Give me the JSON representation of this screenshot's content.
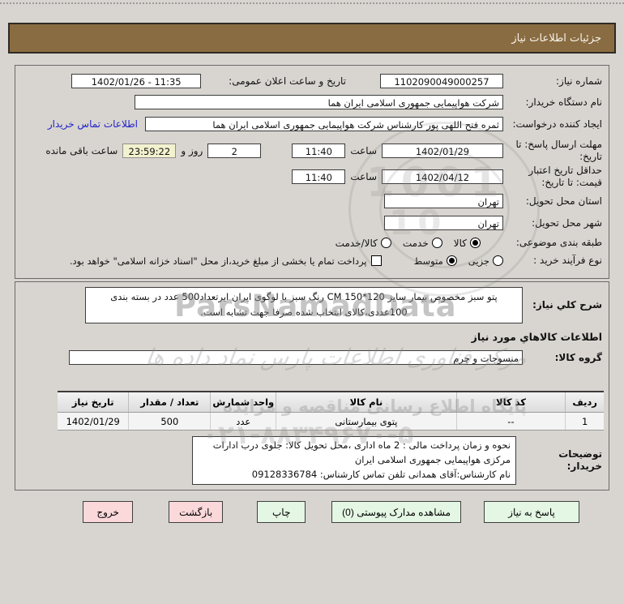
{
  "title_bar": {
    "label": "جزئیات اطلاعات نیاز"
  },
  "colors": {
    "accent_brown": "#8a6c42",
    "link_blue": "#2222cc",
    "countdown_bg": "#f2f2cf",
    "button_green": "#e4f6e4",
    "button_pink": "#fbd8da"
  },
  "panel1": {
    "need_number_label": "شماره نیاز:",
    "need_number_value": "1102090049000257",
    "announce_label": "تاریخ و ساعت اعلان عمومی:",
    "announce_value": "1402/01/26 - 11:35",
    "buyer_org_label": "نام دستگاه خریدار:",
    "buyer_org_value": "شرکت هواپیمایی جمهوری اسلامی ایران هما",
    "creator_label": "ایجاد کننده درخواست:",
    "creator_value": "ثمره فتح اللهی پور کارشناس شرکت هواپیمایی جمهوری اسلامی ایران هما",
    "contact_link": "اطلاعات تماس خریدار",
    "deadline_label": "مهلت ارسال پاسخ: تا تاریخ:",
    "deadline_date": "1402/01/29",
    "hour_label": "ساعت",
    "deadline_time": "11:40",
    "days_value": "2",
    "days_and_label": "روز و",
    "countdown_value": "23:59:22",
    "remaining_label": "ساعت باقی مانده",
    "validity_label": "حداقل تاریخ اعتبار قیمت: تا تاریخ:",
    "validity_date": "1402/04/12",
    "validity_time": "11:40",
    "province_label": "استان محل تحویل:",
    "province_value": "تهران",
    "city_label": "شهر محل تحویل:",
    "city_value": "تهران",
    "classification_label": "طبقه بندی موضوعی:",
    "class_options": [
      {
        "label": "کالا",
        "selected": true
      },
      {
        "label": "خدمت",
        "selected": false
      },
      {
        "label": "کالا/خدمت",
        "selected": false
      }
    ],
    "process_label": "نوع فرآیند خرید :",
    "process_options": [
      {
        "label": "جزیی",
        "selected": false
      },
      {
        "label": "متوسط",
        "selected": true
      }
    ],
    "treasury_checkbox_label": "پرداخت تمام یا بخشی از مبلغ خرید،از محل \"اسناد خزانه اسلامی\" خواهد بود.",
    "treasury_checked": false
  },
  "panel2": {
    "desc_label": "شرح کلي نیاز:",
    "desc_value": "پتو سبز مخصوص بیمار سایز  120*150 CM رنگ سبز با لوگوی ایران ایرتعداد500 عدد در بسته بندی 100عددی،کالای انتخاب شده صرفا جهت تشابه است.",
    "goods_info_heading": "اطلاعات کالاهاي مورد نیاز",
    "group_label": "گروه کالا:",
    "group_value": "منسوجات و چرم",
    "table": {
      "headers": [
        "ردیف",
        "کد کالا",
        "نام کالا",
        "واحد شمارش",
        "تعداد / مقدار",
        "تاریخ نیاز"
      ],
      "rows": [
        [
          "1",
          "--",
          "پتوی بیمارستانی",
          "عدد",
          "500",
          "1402/01/29"
        ]
      ]
    },
    "buyer_notes_label": "توضیحات خریدار:",
    "buyer_notes_lines": [
      "نحوه و زمان پرداخت مالی  : 2 ماه اداری ،محل تحویل کالا: جلوی درب ادارات مرکزی هواپیمایی جمهوری اسلامی ایران",
      "نام کارشناس:آقای همدانی  تلفن تماس کارشناس:   09128336784"
    ]
  },
  "buttons": [
    {
      "label": "پاسخ به نیاز",
      "variant": "green"
    },
    {
      "label": "مشاهده مدارک پیوستی (0)",
      "variant": "green"
    },
    {
      "label": "چاپ",
      "variant": "green"
    },
    {
      "label": "بازگشت",
      "variant": "pink"
    },
    {
      "label": "خروج",
      "variant": "pink"
    }
  ],
  "watermark": {
    "latin": "ParsNamadData",
    "calligraphy": "مرکز فناوری اطلاعات پارس نماد داده ها",
    "site_line": "پایگاه اطلاع رسانی مناقصه و مزایده",
    "phone": "۰۲۱-۸۸۳۴۹۶۷۰-۵",
    "digits": "1001",
    "digits2": "10"
  }
}
